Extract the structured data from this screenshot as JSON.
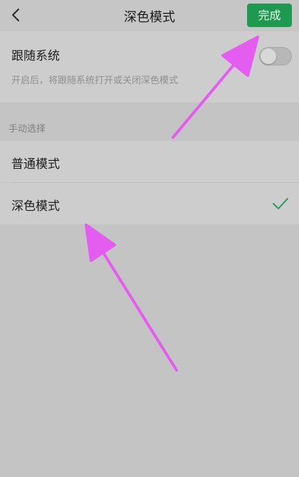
{
  "header": {
    "title": "深色模式",
    "done_label": "完成",
    "back_icon": "chevron-left-icon"
  },
  "follow_system": {
    "title": "跟随系统",
    "description": "开启后，将跟随系统打开或关闭深色模式",
    "enabled": false
  },
  "manual": {
    "section_label": "手动选择",
    "options": [
      {
        "label": "普通模式",
        "selected": false
      },
      {
        "label": "深色模式",
        "selected": true
      }
    ]
  },
  "colors": {
    "accent": "#1e9a50",
    "check": "#2a9b5a",
    "annotation_arrow": "#e55cf0"
  }
}
